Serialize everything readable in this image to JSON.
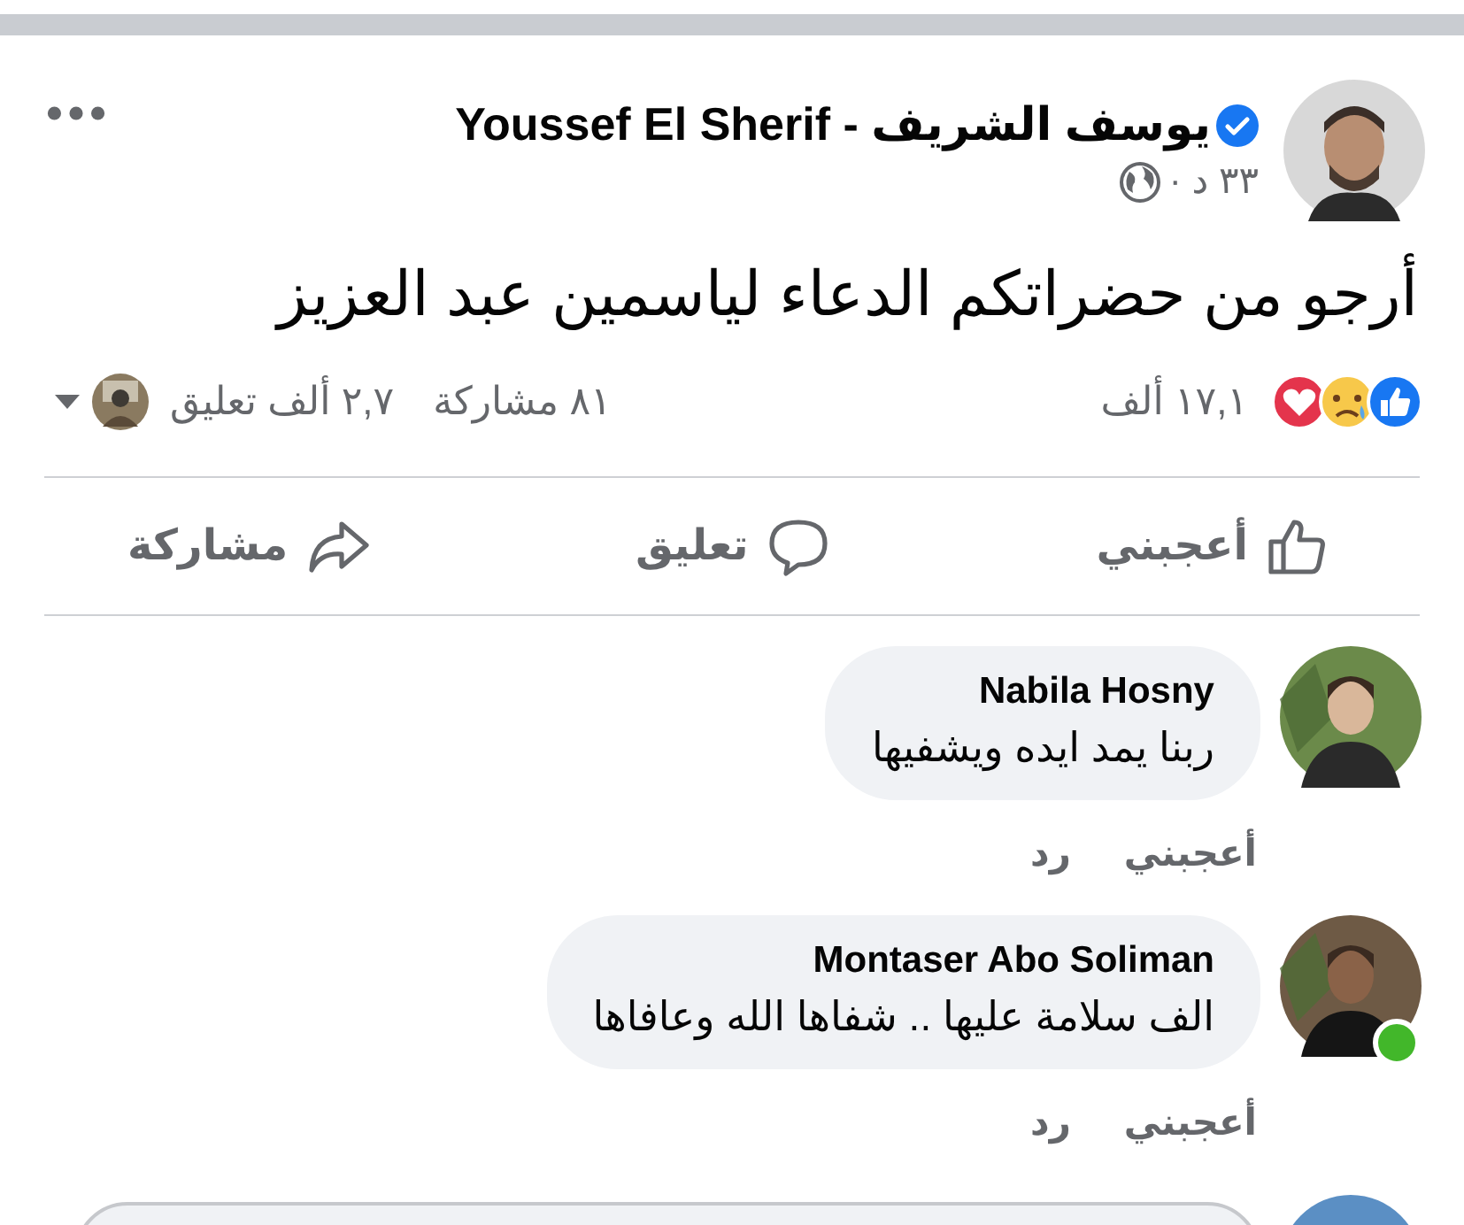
{
  "post": {
    "author": "يوسف  الشريف - Youssef El Sherif",
    "verified": true,
    "time": "٣٣ د ·",
    "text": "أرجو من حضراتكم الدعاء لياسمين عبد العزيز",
    "reactions_count": "١٧,١ ألف",
    "shares": "٨١ مشاركة",
    "comments_count": "٢,٧ ألف تعليق"
  },
  "actions": [
    {
      "kind": "like",
      "label": "أعجبني"
    },
    {
      "kind": "comment",
      "label": "تعليق"
    },
    {
      "kind": "share",
      "label": "مشاركة"
    }
  ],
  "comments": [
    {
      "author": "Nabila Hosny",
      "text": "ربنا يمد ايده ويشفيها",
      "online": false,
      "actions": [
        "أعجبني",
        "رد"
      ]
    },
    {
      "author": "Montaser Abo Soliman",
      "text": "الف سلامة عليها .. شفاها الله وعافاها",
      "online": true,
      "actions": [
        "أعجبني",
        "رد"
      ]
    }
  ]
}
